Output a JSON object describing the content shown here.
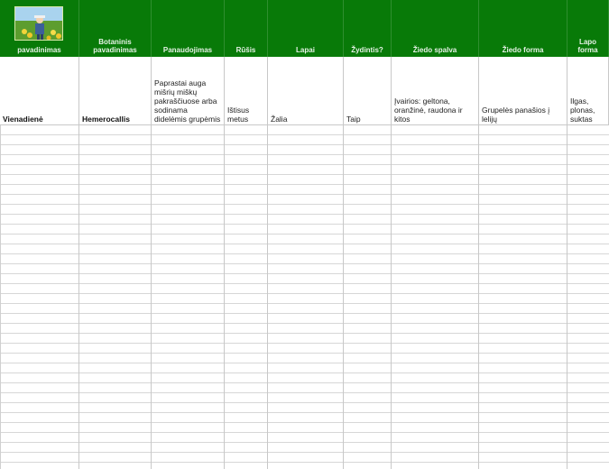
{
  "headers": [
    "pavadinimas",
    "Botaninis\npavadinimas",
    "Panaudojimas",
    "Rūšis",
    "Lapai",
    "Žydintis?",
    "Žiedo spalva",
    "Žiedo forma",
    "Lapo\nforma"
  ],
  "row": [
    "Vienadienė",
    "Hemerocallis",
    "Paprastai auga mišrių miškų pakraščiuose arba sodinama didelėmis grupėmis",
    "Ištisus metus",
    "Žalia",
    "Taip",
    "Įvairios: geltona, oranžinė, raudona ir kitos",
    "Grupelės panašios į lelijų",
    "Ilgas, plonas, suktas"
  ],
  "colors": {
    "header_bg": "#087a08",
    "header_text": "#e6f2e6",
    "grid": "#d7d7d7"
  },
  "logo_icon": "garden-photo-icon"
}
